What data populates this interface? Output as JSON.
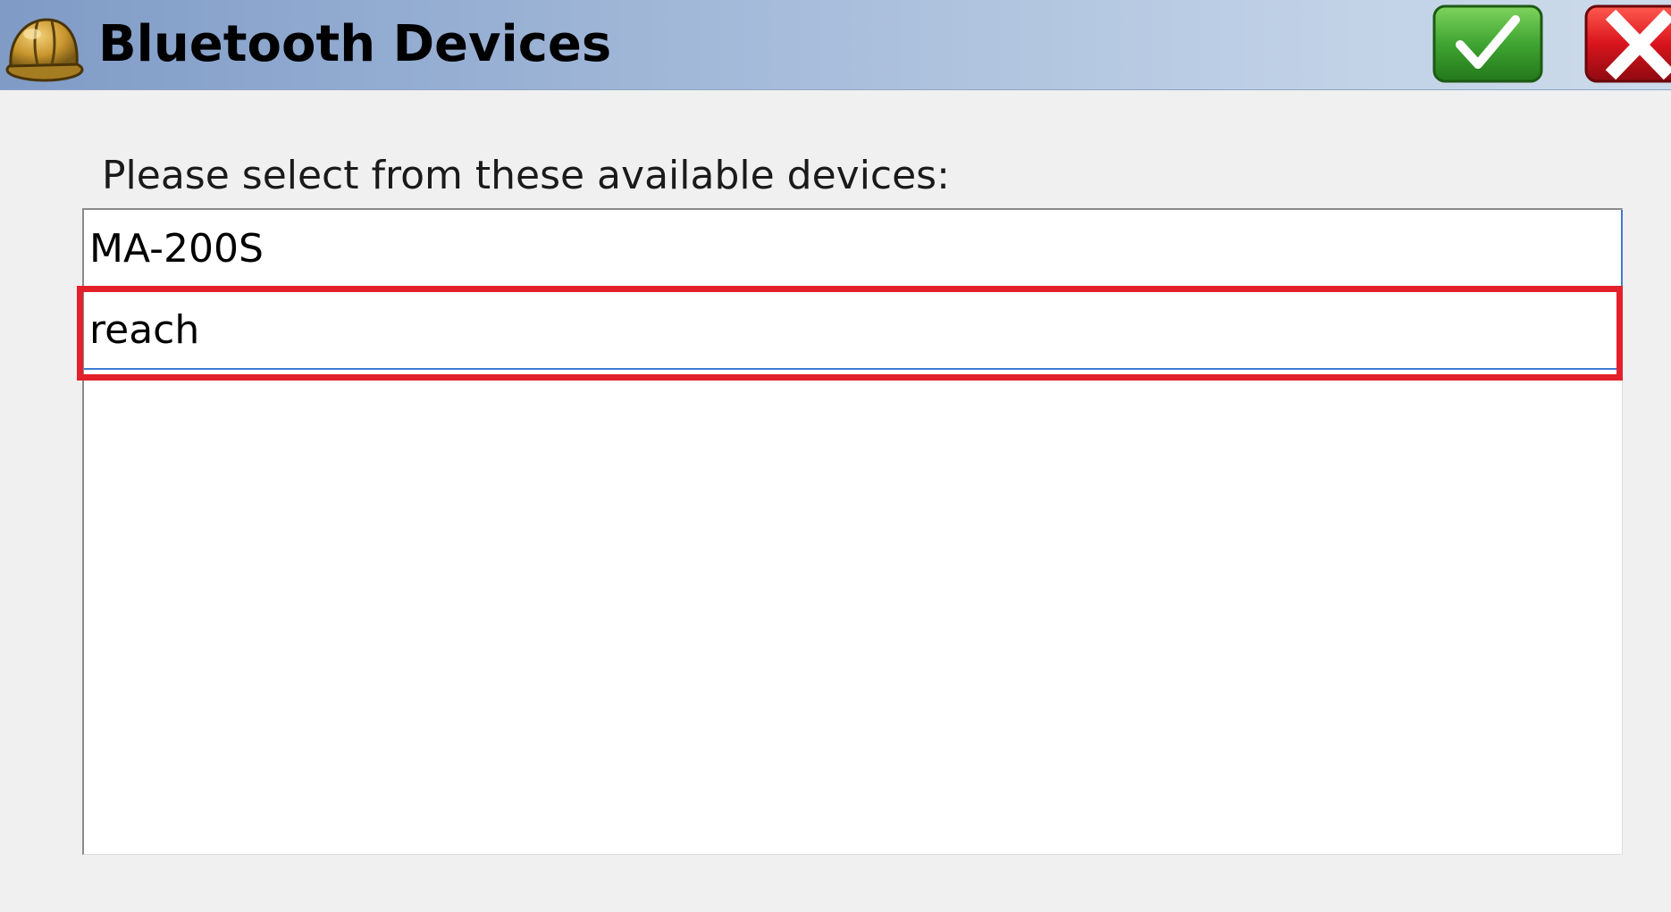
{
  "window": {
    "title": "Bluetooth Devices",
    "app_icon": "hard-hat-icon",
    "ok_icon": "checkmark-icon",
    "cancel_icon": "close-x-icon"
  },
  "dialog": {
    "prompt": "Please select from these available devices:",
    "devices": [
      {
        "name": "MA-200S"
      },
      {
        "name": "reach"
      }
    ],
    "highlighted_device": "reach"
  },
  "colors": {
    "titlebar_start": "#7f9bc6",
    "titlebar_end": "#cddbea",
    "ok_green": "#3fa531",
    "cancel_red": "#d9141d",
    "highlight_red": "#e3202b",
    "selection_blue": "#3d7bd4"
  }
}
